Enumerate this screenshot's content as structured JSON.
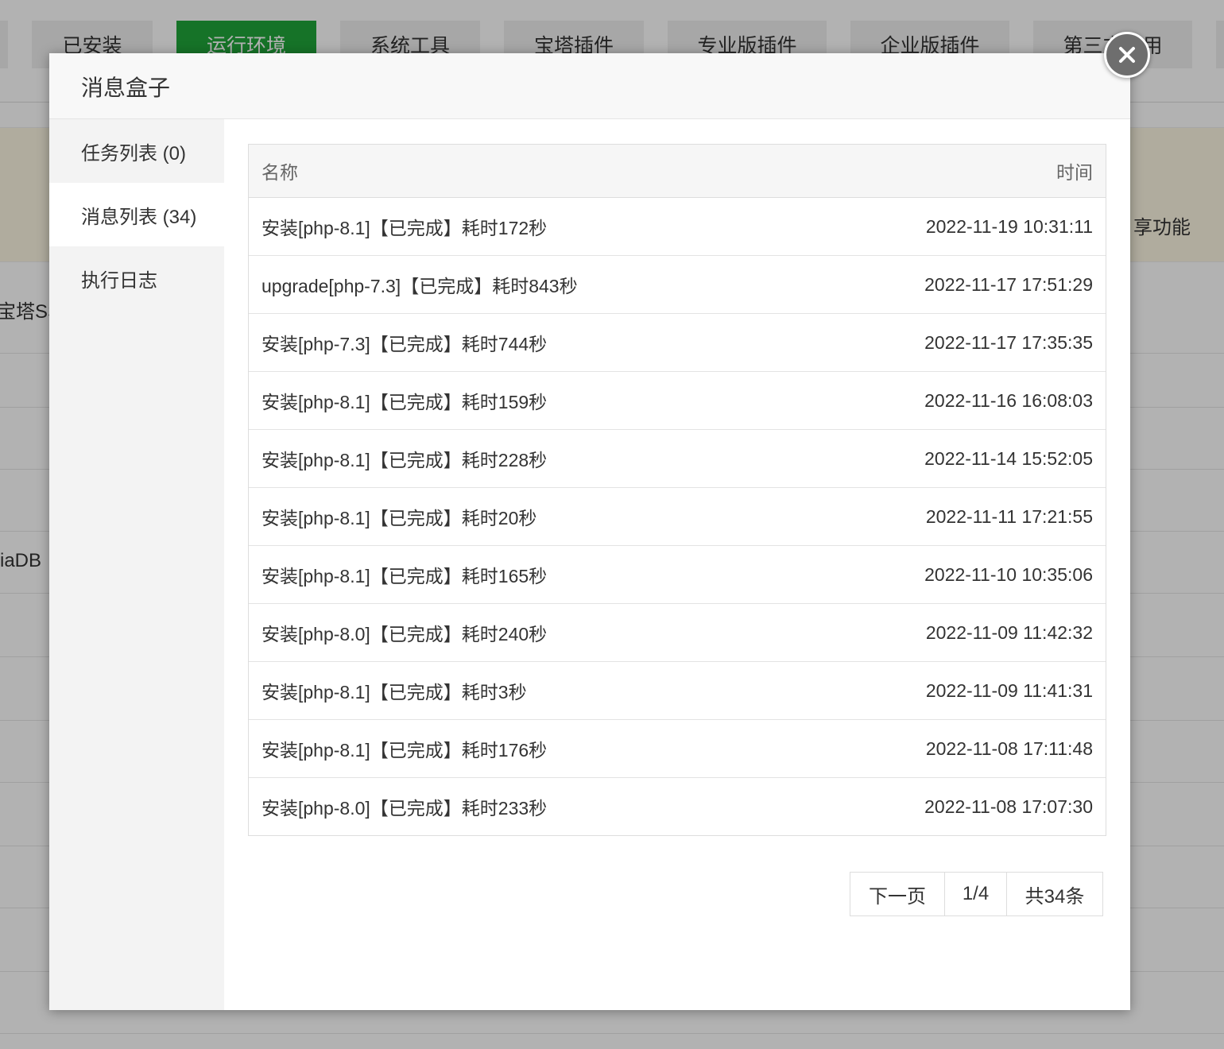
{
  "background": {
    "tabs": [
      "已安装",
      "运行环境",
      "系统工具",
      "宝塔插件",
      "专业版插件",
      "企业版插件",
      "第三方应用"
    ],
    "active_tab_index": 1,
    "fragment_left_1": "宝塔SS",
    "fragment_left_2": "iaDB",
    "fragment_right": "享功能"
  },
  "modal": {
    "title": "消息盒子",
    "close_label": "×",
    "sidebar": [
      {
        "label": "任务列表 (0)"
      },
      {
        "label": "消息列表 (34)"
      },
      {
        "label": "执行日志"
      }
    ],
    "active_sidebar_index": 1,
    "table": {
      "col_name": "名称",
      "col_time": "时间",
      "rows": [
        {
          "name": "安装[php-8.1]【已完成】耗时172秒",
          "time": "2022-11-19 10:31:11"
        },
        {
          "name": "upgrade[php-7.3]【已完成】耗时843秒",
          "time": "2022-11-17 17:51:29"
        },
        {
          "name": "安装[php-7.3]【已完成】耗时744秒",
          "time": "2022-11-17 17:35:35"
        },
        {
          "name": "安装[php-8.1]【已完成】耗时159秒",
          "time": "2022-11-16 16:08:03"
        },
        {
          "name": "安装[php-8.1]【已完成】耗时228秒",
          "time": "2022-11-14 15:52:05"
        },
        {
          "name": "安装[php-8.1]【已完成】耗时20秒",
          "time": "2022-11-11 17:21:55"
        },
        {
          "name": "安装[php-8.1]【已完成】耗时165秒",
          "time": "2022-11-10 10:35:06"
        },
        {
          "name": "安装[php-8.0]【已完成】耗时240秒",
          "time": "2022-11-09 11:42:32"
        },
        {
          "name": "安装[php-8.1]【已完成】耗时3秒",
          "time": "2022-11-09 11:41:31"
        },
        {
          "name": "安装[php-8.1]【已完成】耗时176秒",
          "time": "2022-11-08 17:11:48"
        },
        {
          "name": "安装[php-8.0]【已完成】耗时233秒",
          "time": "2022-11-08 17:07:30"
        }
      ]
    },
    "pager": {
      "next_label": "下一页",
      "page_label": "1/4",
      "total_label": "共34条"
    }
  }
}
